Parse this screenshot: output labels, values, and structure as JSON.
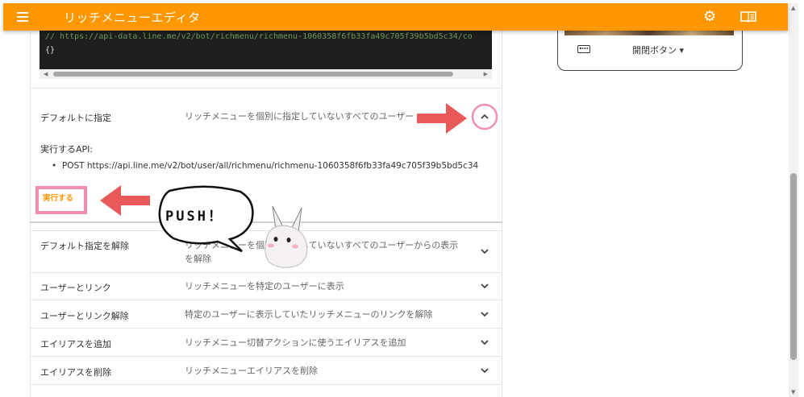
{
  "app": {
    "title": "リッチメニューエディタ"
  },
  "code": {
    "comment_line": "// https://api-data.line.me/v2/bot/richmenu/richmenu-1060358f6fb33fa49c705f39b5bd5c34/co",
    "body_line": "{}"
  },
  "expanded": {
    "name": "デフォルトに指定",
    "desc": "リッチメニューを個別に指定していないすべてのユーザー",
    "api_label": "実行するAPI:",
    "api_item": "POST https://api.line.me/v2/bot/user/all/richmenu/richmenu-1060358f6fb33fa49c705f39b5bd5c34",
    "exec_label": "実行する"
  },
  "rows": [
    {
      "name": "デフォルト指定を解除",
      "desc_line1": "リッチメニューを個別に指定していないすべてのユーザーからの表示",
      "desc_line2": "を解除"
    },
    {
      "name": "ユーザーとリンク",
      "desc_line1": "リッチメニューを特定のユーザーに表示"
    },
    {
      "name": "ユーザーとリンク解除",
      "desc_line1": "特定のユーザーに表示していたリッチメニューのリンクを解除"
    },
    {
      "name": "エイリアスを追加",
      "desc_line1": "リッチメニュー切替アクションに使うエイリアスを追加"
    },
    {
      "name": "エイリアスを削除",
      "desc_line1": "リッチメニューエイリアスを削除"
    }
  ],
  "phone": {
    "toggle_label": "開閉ボタン ▾"
  },
  "annotation": {
    "bubble_text": "PUSH！"
  },
  "colors": {
    "accent": "#ff9800",
    "annotation_red": "#e85a5a",
    "highlight_pink": "#f48fb1"
  },
  "icons": [
    "menu-icon",
    "gear-icon",
    "book-icon",
    "keyboard-icon",
    "chevron-up-icon",
    "chevron-down-icon"
  ]
}
